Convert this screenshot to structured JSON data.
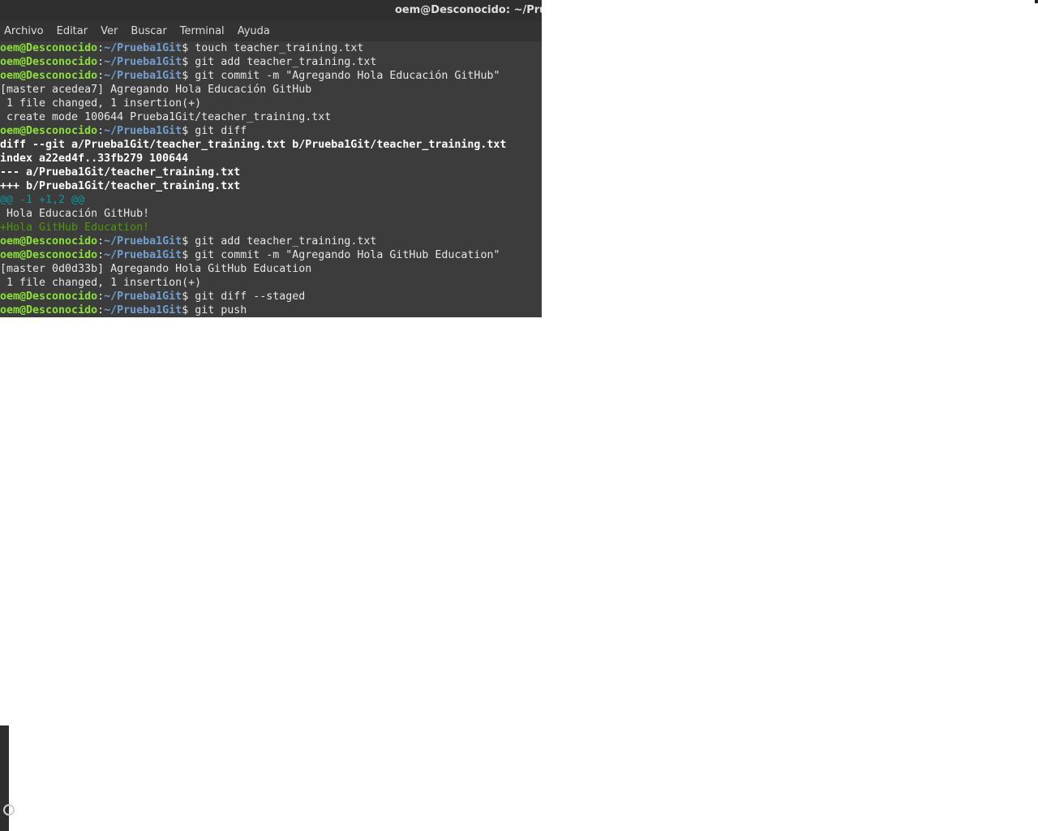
{
  "window": {
    "title": "oem@Desconocido: ~/Prueba"
  },
  "menu": {
    "items": [
      "Archivo",
      "Editar",
      "Ver",
      "Buscar",
      "Terminal",
      "Ayuda"
    ]
  },
  "prompt": {
    "user": "oem@Desconocido",
    "path": "~/Prueba1Git",
    "symbol": "$ "
  },
  "terminal": {
    "lines": [
      {
        "kind": "prompt",
        "cmd": "touch teacher_training.txt"
      },
      {
        "kind": "prompt",
        "cmd": "git add teacher_training.txt"
      },
      {
        "kind": "prompt",
        "cmd": "git commit -m \"Agregando Hola Educación GitHub\""
      },
      {
        "kind": "text",
        "text": "[master acedea7] Agregando Hola Educación GitHub"
      },
      {
        "kind": "text",
        "text": " 1 file changed, 1 insertion(+)"
      },
      {
        "kind": "text",
        "text": " create mode 100644 Prueba1Git/teacher_training.txt"
      },
      {
        "kind": "prompt",
        "cmd": "git diff"
      },
      {
        "kind": "bold",
        "text": "diff --git a/Prueba1Git/teacher_training.txt b/Prueba1Git/teacher_training.txt"
      },
      {
        "kind": "bold",
        "text": "index a22ed4f..33fb279 100644"
      },
      {
        "kind": "bold",
        "text": "--- a/Prueba1Git/teacher_training.txt"
      },
      {
        "kind": "bold",
        "text": "+++ b/Prueba1Git/teacher_training.txt"
      },
      {
        "kind": "hunk",
        "text": "@@ -1 +1,2 @@"
      },
      {
        "kind": "text",
        "text": " Hola Educación GitHub!"
      },
      {
        "kind": "added",
        "text": "+Hola GitHub Education!"
      },
      {
        "kind": "prompt",
        "cmd": "git add teacher_training.txt"
      },
      {
        "kind": "prompt",
        "cmd": "git commit -m \"Agregando Hola GitHub Education\""
      },
      {
        "kind": "text",
        "text": "[master 0d0d33b] Agregando Hola GitHub Education"
      },
      {
        "kind": "text",
        "text": " 1 file changed, 1 insertion(+)"
      },
      {
        "kind": "prompt",
        "cmd": "git diff --staged"
      },
      {
        "kind": "prompt",
        "cmd": "git push"
      }
    ]
  },
  "colors": {
    "user": "#8ae234",
    "path": "#729fcf",
    "hunk": "#06989a",
    "added": "#4e9a06",
    "background": "#3c3c3c"
  },
  "icons": {
    "dock": "circle-icon"
  }
}
